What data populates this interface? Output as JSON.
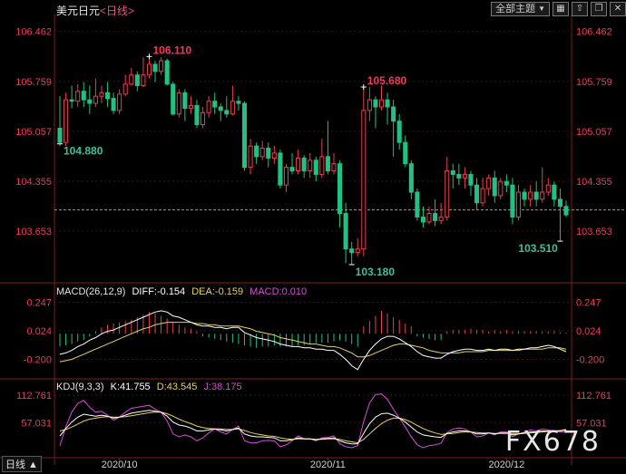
{
  "header": {
    "symbol": "美元日元",
    "period": "<日线>",
    "theme_label": "全部主题",
    "theme_caret": "▼"
  },
  "colors": {
    "up": "#e5414e",
    "down": "#22c084",
    "up_text": "#ef3b5a",
    "down_text": "#3ec19a",
    "diff": "#ffffff",
    "dea": "#e5d35a",
    "macd": "#d84cd8",
    "k": "#ffffff",
    "d": "#e5d35a",
    "j": "#d84cd8",
    "ref_line": "#e08f1b",
    "grid": "#3a1515",
    "axis": "#7a1e1e"
  },
  "price_axis": {
    "ticks": [
      "106.462",
      "105.759",
      "105.057",
      "104.355",
      "103.653"
    ]
  },
  "x_axis": {
    "ticks": [
      "2020/10",
      "2020/11",
      "2020/12"
    ]
  },
  "chart_data": {
    "type": "candlestick",
    "title": "美元日元<日线>",
    "ylim": [
      102.95,
      106.65
    ],
    "reference_price": 103.95,
    "annotations": [
      {
        "label": "106.110",
        "kind": "high"
      },
      {
        "label": "104.880",
        "kind": "low"
      },
      {
        "label": "105.680",
        "kind": "high"
      },
      {
        "label": "103.180",
        "kind": "low"
      },
      {
        "label": "103.510",
        "kind": "low"
      }
    ],
    "candles": [
      [
        105.1,
        104.9,
        105.55,
        104.85
      ],
      [
        104.9,
        105.5,
        105.6,
        104.85
      ],
      [
        105.5,
        105.48,
        105.7,
        105.38
      ],
      [
        105.48,
        105.62,
        105.72,
        105.4
      ],
      [
        105.62,
        105.5,
        105.75,
        105.4
      ],
      [
        105.5,
        105.45,
        105.7,
        105.3
      ],
      [
        105.45,
        105.55,
        105.8,
        105.4
      ],
      [
        105.55,
        105.6,
        105.7,
        105.45
      ],
      [
        105.6,
        105.52,
        105.75,
        105.4
      ],
      [
        105.52,
        105.35,
        105.6,
        105.3
      ],
      [
        105.35,
        105.58,
        105.65,
        105.3
      ],
      [
        105.58,
        105.72,
        105.85,
        105.55
      ],
      [
        105.72,
        105.85,
        105.95,
        105.7
      ],
      [
        105.85,
        105.7,
        105.9,
        105.62
      ],
      [
        105.7,
        105.85,
        106.1,
        105.68
      ],
      [
        105.85,
        106.0,
        106.11,
        105.8
      ],
      [
        106.0,
        105.9,
        106.05,
        105.75
      ],
      [
        105.9,
        106.05,
        106.1,
        105.85
      ],
      [
        106.05,
        105.72,
        106.08,
        105.7
      ],
      [
        105.72,
        105.3,
        105.75,
        105.28
      ],
      [
        105.3,
        105.6,
        105.65,
        105.25
      ],
      [
        105.6,
        105.38,
        105.65,
        105.2
      ],
      [
        105.38,
        105.42,
        105.55,
        105.3
      ],
      [
        105.42,
        105.15,
        105.5,
        105.1
      ],
      [
        105.15,
        105.32,
        105.4,
        105.1
      ],
      [
        105.32,
        105.48,
        105.55,
        105.25
      ],
      [
        105.48,
        105.4,
        105.6,
        105.3
      ],
      [
        105.4,
        105.35,
        105.45,
        105.2
      ],
      [
        105.35,
        105.3,
        105.55,
        105.25
      ],
      [
        105.3,
        105.48,
        105.7,
        105.28
      ],
      [
        105.48,
        105.45,
        105.55,
        105.35
      ],
      [
        105.45,
        104.55,
        105.48,
        104.5
      ],
      [
        104.55,
        104.85,
        104.95,
        104.45
      ],
      [
        104.85,
        104.7,
        104.9,
        104.6
      ],
      [
        104.7,
        104.82,
        104.92,
        104.65
      ],
      [
        104.82,
        104.68,
        104.9,
        104.55
      ],
      [
        104.68,
        104.75,
        104.85,
        104.6
      ],
      [
        104.75,
        104.3,
        104.8,
        104.25
      ],
      [
        104.3,
        104.55,
        104.6,
        104.2
      ],
      [
        104.55,
        104.5,
        104.75,
        104.45
      ],
      [
        104.5,
        104.68,
        104.8,
        104.45
      ],
      [
        104.68,
        104.5,
        104.72,
        104.4
      ],
      [
        104.5,
        104.65,
        104.75,
        104.4
      ],
      [
        104.65,
        104.45,
        104.7,
        104.35
      ],
      [
        104.45,
        104.7,
        104.95,
        104.4
      ],
      [
        104.7,
        104.5,
        105.2,
        104.45
      ],
      [
        104.5,
        104.6,
        104.75,
        104.45
      ],
      [
        104.6,
        103.9,
        104.65,
        103.7
      ],
      [
        103.9,
        103.4,
        104.05,
        103.2
      ],
      [
        103.4,
        103.35,
        103.5,
        103.18
      ],
      [
        103.35,
        103.4,
        103.55,
        103.3
      ],
      [
        103.4,
        105.35,
        105.68,
        103.3
      ],
      [
        105.35,
        105.5,
        105.68,
        105.2
      ],
      [
        105.5,
        105.4,
        105.55,
        105.1
      ],
      [
        105.4,
        105.5,
        105.7,
        105.35
      ],
      [
        105.5,
        105.4,
        105.6,
        105.15
      ],
      [
        105.4,
        105.2,
        105.5,
        104.7
      ],
      [
        105.2,
        104.9,
        105.3,
        104.8
      ],
      [
        104.9,
        104.6,
        105.0,
        104.55
      ],
      [
        104.6,
        104.2,
        104.65,
        104.1
      ],
      [
        104.2,
        103.85,
        104.25,
        103.8
      ],
      [
        103.85,
        103.78,
        104.0,
        103.7
      ],
      [
        103.78,
        103.9,
        104.0,
        103.75
      ],
      [
        103.9,
        103.8,
        104.1,
        103.72
      ],
      [
        103.8,
        103.85,
        104.05,
        103.75
      ],
      [
        103.85,
        104.5,
        104.7,
        103.8
      ],
      [
        104.5,
        104.45,
        104.6,
        104.25
      ],
      [
        104.45,
        104.4,
        104.6,
        104.3
      ],
      [
        104.4,
        104.45,
        104.55,
        104.25
      ],
      [
        104.45,
        104.3,
        104.5,
        104.15
      ],
      [
        104.3,
        104.05,
        104.4,
        103.95
      ],
      [
        104.05,
        104.25,
        104.4,
        104.0
      ],
      [
        104.25,
        104.4,
        104.45,
        104.15
      ],
      [
        104.4,
        104.15,
        104.5,
        104.05
      ],
      [
        104.15,
        104.35,
        104.4,
        104.1
      ],
      [
        104.35,
        104.3,
        104.45,
        104.2
      ],
      [
        104.3,
        103.85,
        104.4,
        103.75
      ],
      [
        103.85,
        104.2,
        104.3,
        103.8
      ],
      [
        104.2,
        104.1,
        104.25,
        104.0
      ],
      [
        104.1,
        104.2,
        104.3,
        104.0
      ],
      [
        104.2,
        104.1,
        104.35,
        104.0
      ],
      [
        104.1,
        104.2,
        104.55,
        104.05
      ],
      [
        104.2,
        104.3,
        104.4,
        104.15
      ],
      [
        104.3,
        104.1,
        104.35,
        104.0
      ],
      [
        104.1,
        104.0,
        104.25,
        103.51
      ],
      [
        104.0,
        103.88,
        104.08,
        103.85
      ]
    ],
    "macd": {
      "params": "MACD(26,12,9)",
      "diff_label": "DIFF:-0.154",
      "dea_label": "DEA:-0.159",
      "macd_label": "MACD:0.010",
      "ticks": [
        "0.247",
        "0.024",
        "-0.200"
      ],
      "ylim": [
        -0.31,
        0.3
      ],
      "diff": [
        -0.16,
        -0.15,
        -0.13,
        -0.1,
        -0.08,
        -0.05,
        -0.03,
        0.0,
        0.02,
        0.03,
        0.05,
        0.07,
        0.09,
        0.11,
        0.13,
        0.15,
        0.17,
        0.18,
        0.17,
        0.14,
        0.13,
        0.11,
        0.09,
        0.07,
        0.06,
        0.06,
        0.05,
        0.05,
        0.04,
        0.05,
        0.05,
        0.01,
        -0.01,
        -0.03,
        -0.04,
        -0.05,
        -0.06,
        -0.08,
        -0.09,
        -0.1,
        -0.1,
        -0.11,
        -0.11,
        -0.12,
        -0.12,
        -0.13,
        -0.13,
        -0.16,
        -0.2,
        -0.25,
        -0.28,
        -0.2,
        -0.13,
        -0.08,
        -0.04,
        -0.02,
        -0.02,
        -0.04,
        -0.07,
        -0.1,
        -0.14,
        -0.17,
        -0.18,
        -0.19,
        -0.19,
        -0.16,
        -0.14,
        -0.13,
        -0.12,
        -0.12,
        -0.13,
        -0.13,
        -0.12,
        -0.13,
        -0.12,
        -0.12,
        -0.13,
        -0.12,
        -0.12,
        -0.11,
        -0.11,
        -0.1,
        -0.09,
        -0.1,
        -0.12,
        -0.14
      ],
      "dea": [
        -0.22,
        -0.21,
        -0.2,
        -0.18,
        -0.16,
        -0.14,
        -0.12,
        -0.1,
        -0.08,
        -0.06,
        -0.04,
        -0.02,
        0.0,
        0.02,
        0.04,
        0.05,
        0.07,
        0.08,
        0.09,
        0.09,
        0.09,
        0.09,
        0.09,
        0.08,
        0.08,
        0.07,
        0.07,
        0.06,
        0.06,
        0.06,
        0.06,
        0.05,
        0.04,
        0.02,
        0.01,
        0.0,
        -0.01,
        -0.03,
        -0.04,
        -0.05,
        -0.06,
        -0.07,
        -0.08,
        -0.08,
        -0.09,
        -0.1,
        -0.1,
        -0.11,
        -0.13,
        -0.15,
        -0.18,
        -0.18,
        -0.17,
        -0.15,
        -0.13,
        -0.11,
        -0.09,
        -0.08,
        -0.08,
        -0.09,
        -0.1,
        -0.11,
        -0.13,
        -0.14,
        -0.15,
        -0.15,
        -0.15,
        -0.15,
        -0.14,
        -0.14,
        -0.14,
        -0.14,
        -0.13,
        -0.13,
        -0.13,
        -0.13,
        -0.13,
        -0.13,
        -0.12,
        -0.12,
        -0.12,
        -0.12,
        -0.11,
        -0.11,
        -0.11,
        -0.12
      ],
      "hist": [
        -0.1,
        -0.09,
        -0.08,
        -0.06,
        -0.05,
        -0.02,
        0.02,
        0.05,
        0.07,
        0.08,
        0.09,
        0.1,
        0.11,
        0.13,
        0.15,
        0.17,
        0.16,
        0.14,
        0.12,
        0.09,
        0.07,
        0.05,
        0.04,
        0.02,
        -0.02,
        -0.03,
        -0.04,
        -0.05,
        -0.06,
        -0.07,
        -0.08,
        -0.09,
        -0.1,
        -0.11,
        -0.1,
        -0.1,
        -0.09,
        -0.1,
        -0.1,
        -0.1,
        -0.09,
        -0.09,
        -0.08,
        -0.07,
        -0.07,
        -0.07,
        -0.06,
        -0.05,
        -0.06,
        -0.08,
        -0.1,
        0.06,
        0.1,
        0.14,
        0.18,
        0.16,
        0.13,
        0.11,
        0.08,
        0.06,
        -0.02,
        -0.03,
        -0.04,
        -0.05,
        -0.05,
        0.02,
        0.03,
        0.03,
        0.03,
        0.04,
        0.03,
        0.03,
        0.02,
        0.03,
        0.02,
        0.03,
        0.02,
        0.02,
        0.02,
        0.02,
        0.02,
        0.02,
        0.02,
        0.02,
        0.01,
        0.01
      ]
    },
    "kdj": {
      "params": "KDJ(9,3,3)",
      "k_label": "K:41.755",
      "d_label": "D:43.545",
      "j_label": "J:38.175",
      "ticks": [
        "112.761",
        "57.031"
      ],
      "ylim": [
        -5,
        120
      ],
      "k": [
        30,
        45,
        58,
        68,
        74,
        72,
        70,
        72,
        70,
        66,
        68,
        72,
        76,
        78,
        80,
        82,
        80,
        78,
        70,
        58,
        52,
        50,
        46,
        40,
        40,
        42,
        44,
        42,
        40,
        43,
        46,
        34,
        30,
        28,
        28,
        27,
        26,
        20,
        20,
        22,
        26,
        24,
        24,
        22,
        24,
        25,
        26,
        20,
        16,
        14,
        14,
        35,
        55,
        68,
        75,
        76,
        72,
        66,
        58,
        48,
        38,
        32,
        30,
        28,
        27,
        35,
        38,
        40,
        40,
        38,
        34,
        34,
        36,
        34,
        36,
        36,
        32,
        34,
        36,
        38,
        38,
        40,
        40,
        40,
        40,
        42
      ],
      "d": [
        40,
        43,
        48,
        54,
        60,
        64,
        66,
        68,
        69,
        68,
        68,
        69,
        71,
        73,
        75,
        77,
        78,
        78,
        75,
        70,
        64,
        59,
        55,
        50,
        47,
        45,
        44,
        44,
        43,
        43,
        44,
        41,
        37,
        34,
        32,
        30,
        29,
        26,
        24,
        23,
        24,
        24,
        24,
        23,
        23,
        24,
        24,
        23,
        20,
        18,
        16,
        23,
        34,
        45,
        55,
        62,
        66,
        66,
        63,
        58,
        51,
        45,
        40,
        36,
        33,
        34,
        35,
        37,
        38,
        38,
        37,
        36,
        36,
        35,
        35,
        35,
        34,
        34,
        35,
        36,
        37,
        38,
        39,
        40,
        41,
        43
      ],
      "j": [
        10,
        49,
        78,
        96,
        102,
        88,
        78,
        80,
        72,
        62,
        68,
        78,
        86,
        88,
        90,
        92,
        84,
        78,
        60,
        34,
        28,
        32,
        28,
        20,
        26,
        36,
        44,
        38,
        34,
        43,
        50,
        20,
        16,
        16,
        20,
        21,
        20,
        8,
        12,
        20,
        30,
        24,
        24,
        20,
        26,
        27,
        30,
        14,
        8,
        6,
        10,
        59,
        97,
        114,
        115,
        104,
        84,
        66,
        48,
        28,
        12,
        6,
        10,
        12,
        15,
        37,
        44,
        46,
        44,
        38,
        28,
        30,
        36,
        32,
        38,
        38,
        28,
        34,
        38,
        42,
        40,
        44,
        42,
        40,
        38,
        38
      ]
    }
  },
  "panes": {
    "macd_title": {
      "params": "MACD(26,12,9)",
      "diff": "DIFF:-0.154",
      "dea": "DEA:-0.159",
      "macd": "MACD:0.010"
    },
    "kdj_title": {
      "params": "KDJ(9,3,3)",
      "k": "K:41.755",
      "d": "D:43.545",
      "j": "J:38.175"
    }
  },
  "footer": {
    "timeframe_tag": "日线 ▲",
    "watermark": "FX678"
  }
}
